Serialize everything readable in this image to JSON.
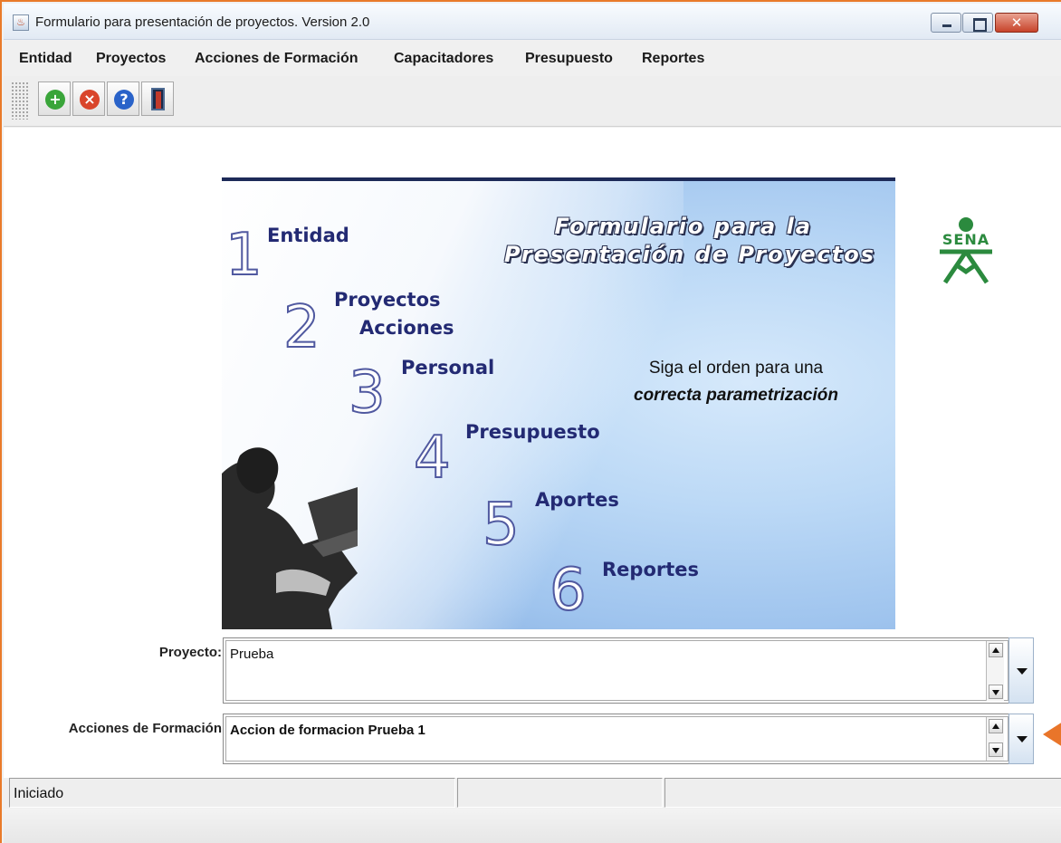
{
  "window": {
    "title": "Formulario para presentación de proyectos. Version 2.0",
    "app_icon": "java-icon"
  },
  "menu": {
    "items": [
      "Entidad",
      "Proyectos",
      "Acciones de Formación",
      "Capacitadores",
      "Presupuesto",
      "Reportes"
    ]
  },
  "toolbar": {
    "buttons": [
      {
        "name": "add",
        "icon": "plus-icon",
        "glyph": "+",
        "color": "#3aa53a"
      },
      {
        "name": "delete",
        "icon": "remove-icon",
        "glyph": "×",
        "color": "#d9452b"
      },
      {
        "name": "help",
        "icon": "help-icon",
        "glyph": "?",
        "color": "#2a63c9"
      },
      {
        "name": "exit",
        "icon": "exit-door-icon",
        "glyph": "",
        "color": "#1a2a4a"
      }
    ]
  },
  "banner": {
    "heading_line1": "Formulario para la",
    "heading_line2": "Presentación de Proyectos",
    "steps": [
      {
        "number": "1",
        "label": "Entidad"
      },
      {
        "number": "2",
        "label": "Proyectos"
      },
      {
        "number": "",
        "label": "Acciones"
      },
      {
        "number": "3",
        "label": "Personal"
      },
      {
        "number": "4",
        "label": "Presupuesto"
      },
      {
        "number": "5",
        "label": "Aportes"
      },
      {
        "number": "6",
        "label": "Reportes"
      }
    ],
    "hint_line1": "Siga el orden para una",
    "hint_line2": "correcta parametrización"
  },
  "logo": {
    "text": "SENA",
    "color": "#2b8a3e"
  },
  "form": {
    "proyecto_label": "Proyecto:",
    "proyecto_value": "Prueba",
    "acciones_label": "Acciones de Formación",
    "acciones_value": "Accion de formacion Prueba 1"
  },
  "status": {
    "text": "Iniciado"
  },
  "colors": {
    "accent_orange": "#e9752a",
    "banner_navy": "#232a73"
  }
}
